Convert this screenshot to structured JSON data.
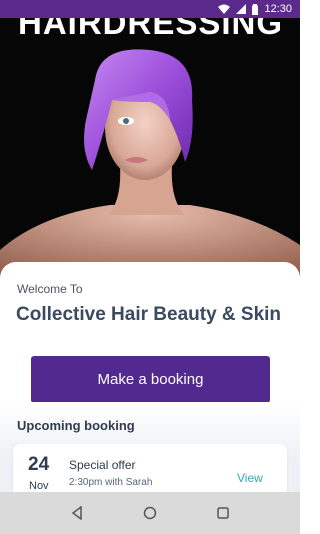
{
  "status_bar": {
    "time": "12:30",
    "icons": [
      "wifi-icon",
      "signal-icon",
      "battery-icon"
    ]
  },
  "hero": {
    "headline": "HAIRDRESSING",
    "image": "model-with-purple-bob-haircut"
  },
  "welcome": {
    "label": "Welcome To",
    "salon_name": "Collective Hair Beauty & Skin"
  },
  "actions": {
    "book_label": "Make a booking"
  },
  "upcoming": {
    "title": "Upcoming booking",
    "booking": {
      "day": "24",
      "month": "Nov",
      "title": "Special offer",
      "subtitle": "2:30pm with Sarah",
      "action": "View"
    }
  },
  "nav_bar": {
    "buttons": [
      "back-icon",
      "home-icon",
      "recents-icon"
    ]
  },
  "colors": {
    "brand": "#522a8f",
    "accent": "#3aa6b8",
    "text": "#2f3b50"
  }
}
